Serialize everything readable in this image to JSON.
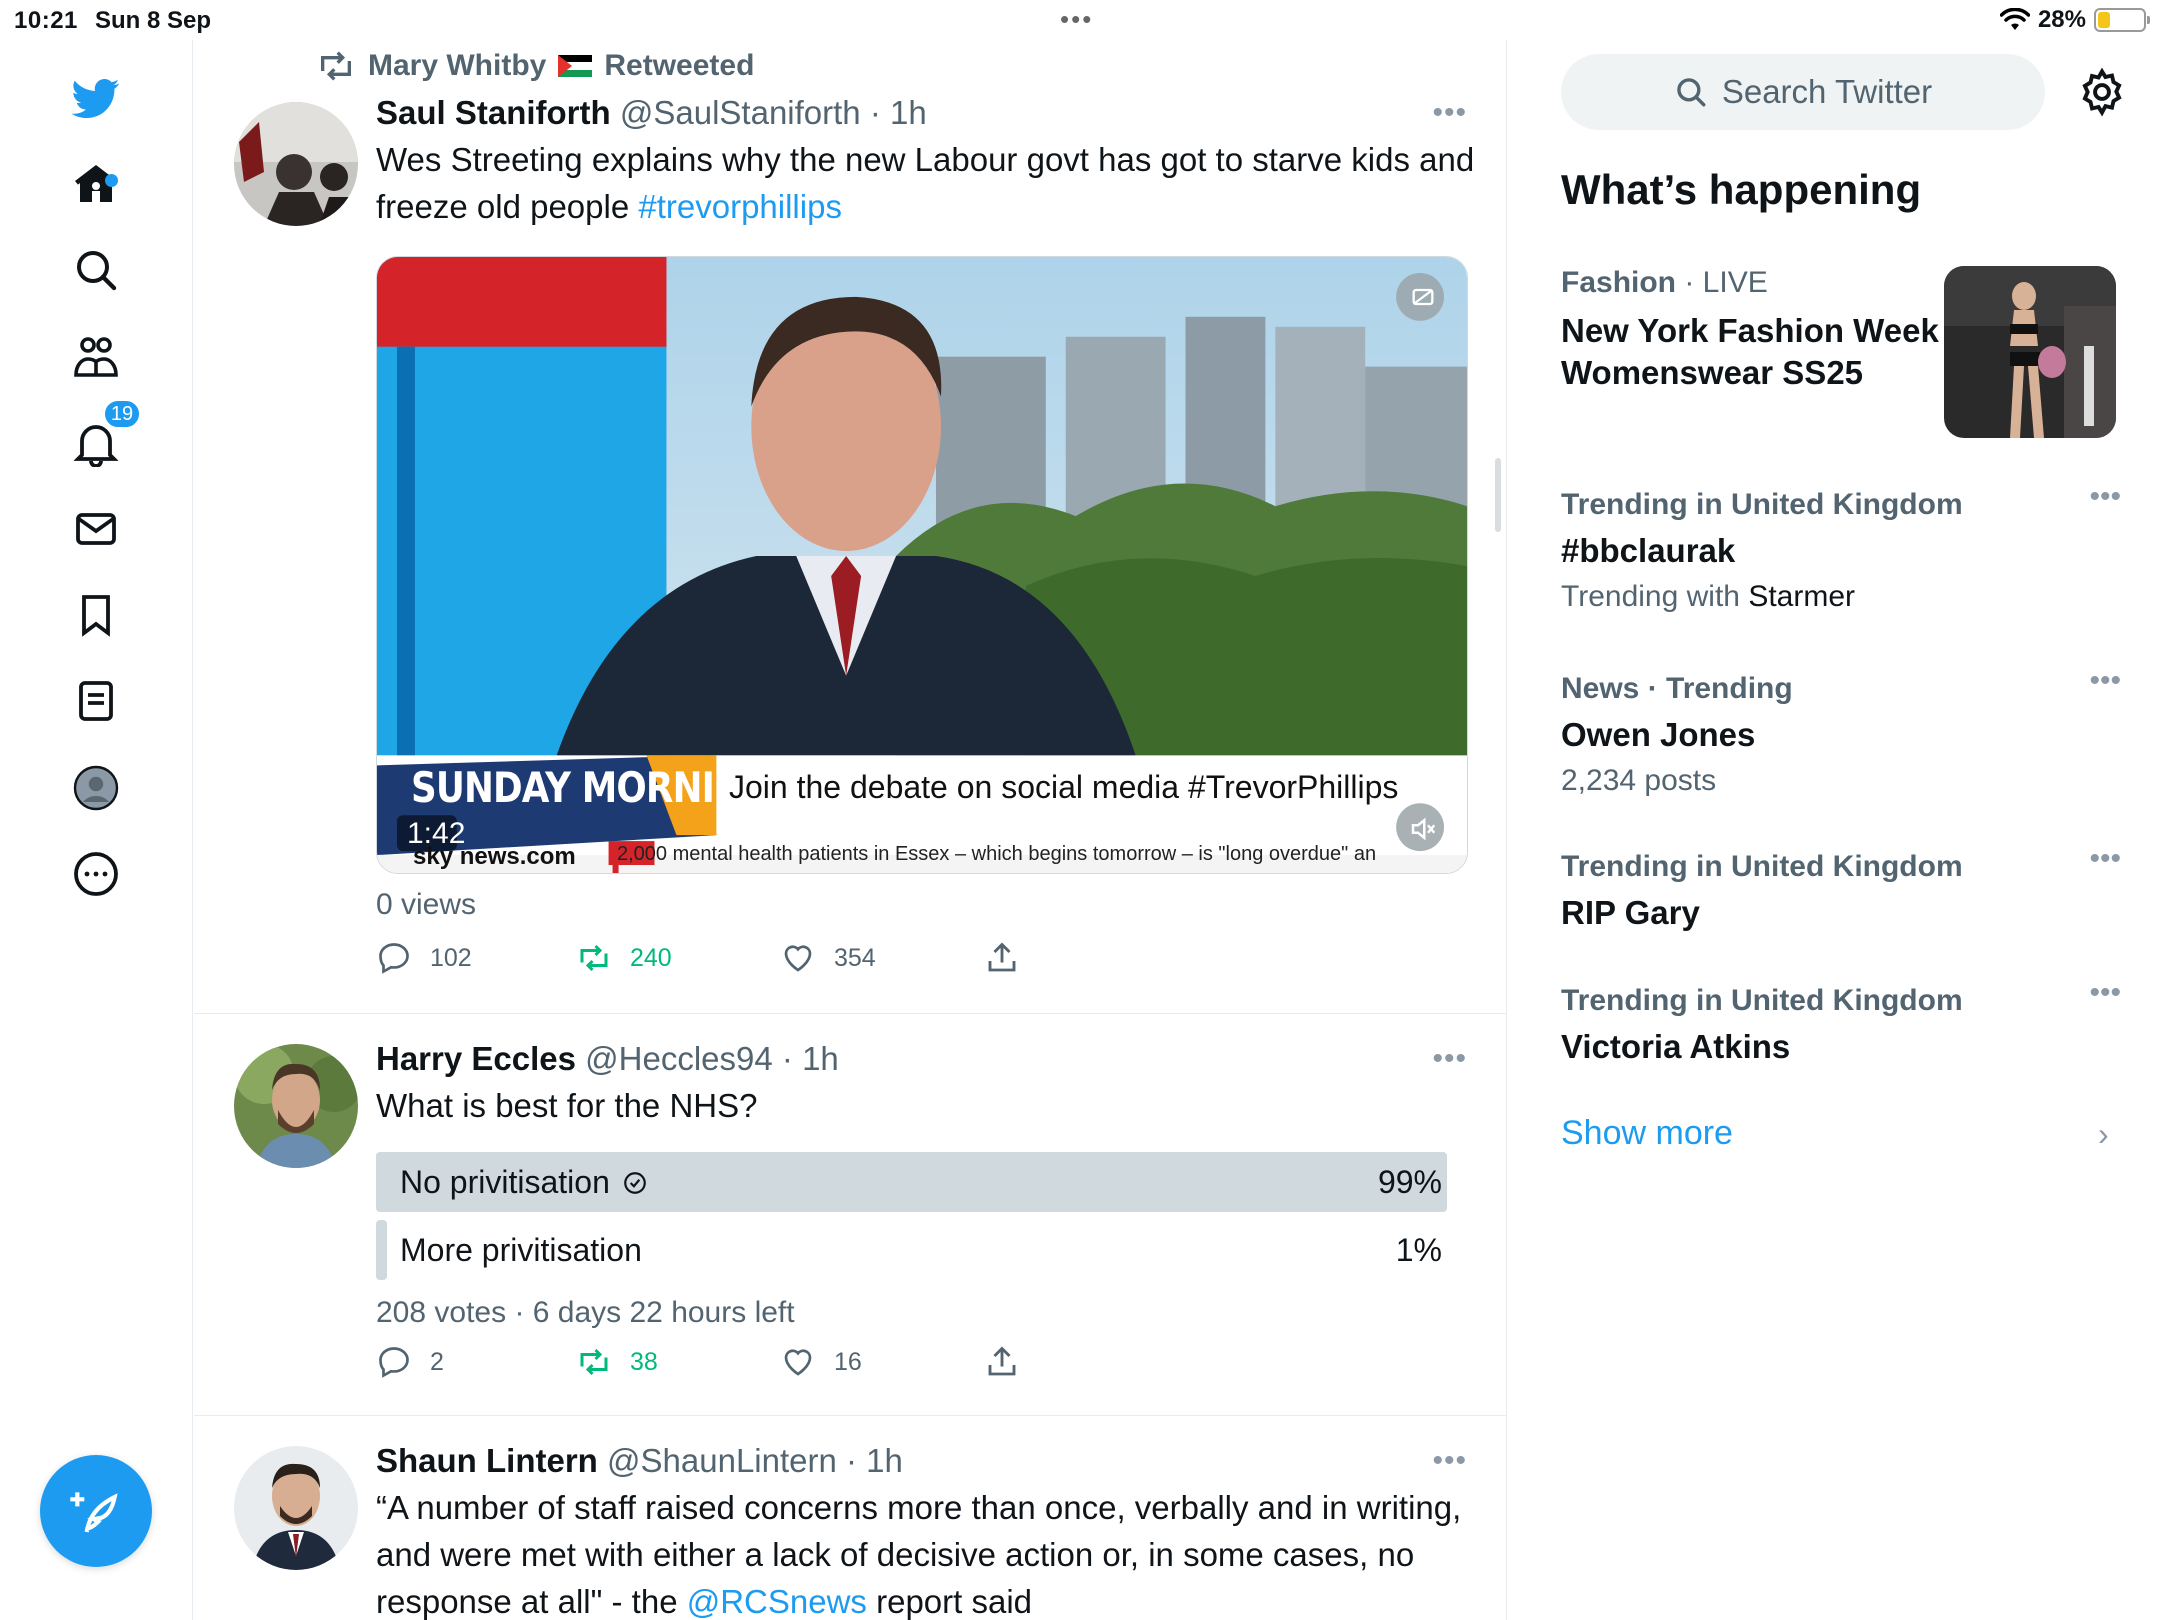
{
  "status_bar": {
    "time": "10:21",
    "date": "Sun 8 Sep",
    "battery": "28%",
    "battery_level": 0.28
  },
  "colors": {
    "accent": "#1d9bf0",
    "retweet_green": "#00ba7c",
    "muted": "#536471"
  },
  "nav": {
    "items": [
      "twitter-logo-icon",
      "home-icon",
      "search-icon",
      "communities-icon",
      "notifications-icon",
      "messages-icon",
      "bookmarks-icon",
      "lists-icon",
      "profile-icon",
      "more-icon"
    ],
    "notification_count": "19"
  },
  "tweets": [
    {
      "retweeted_by": "Mary Whitby",
      "retweeted_label": "Retweeted",
      "name": "Saul Staniforth",
      "handle": "@SaulStaniforth",
      "time": "· 1h",
      "text": "Wes Streeting explains why the new Labour govt has got to starve kids and freeze old people ",
      "hashtag": "#trevorphillips",
      "video": {
        "duration": "1:42",
        "banner": "SUNDAY MORNING",
        "caption": "Join the debate on social media #TrevorPhillips",
        "brand": "sky news",
        "brand_suffix": ".com",
        "ticker": "2,000 mental health patients in Essex – which begins tomorrow – is \"long overdue\" an"
      },
      "views": "0 views",
      "replies": "102",
      "retweets": "240",
      "likes": "354"
    },
    {
      "name": "Harry Eccles",
      "handle": "@Heccles94",
      "time": "· 1h",
      "text": "What is best for the NHS?",
      "poll": {
        "options": [
          {
            "label": "No privitisation",
            "pct": "99%",
            "fraction": 0.99
          },
          {
            "label": "More privitisation",
            "pct": "1%",
            "fraction": 0.01
          }
        ],
        "votes": "208 votes",
        "time_left": "· 6 days 22 hours left"
      },
      "replies": "2",
      "retweets": "38",
      "likes": "16"
    },
    {
      "name": "Shaun Lintern",
      "handle": "@ShaunLintern",
      "time": "· 1h",
      "text_before": "“A number of staff raised concerns more than once, verbally and in writing, and were met with either a lack of decisive action or, in some cases, no response at all\" - the ",
      "mention": "@RCSnews",
      "text_after": " report said"
    }
  ],
  "sidebar": {
    "search_placeholder": "Search Twitter",
    "title": "What’s happening",
    "trends": [
      {
        "category": "Fashion",
        "live": "· LIVE",
        "title": "New York Fashion Week Womenswear SS25"
      },
      {
        "category": "Trending in United Kingdom",
        "title": "#bbclaurak",
        "sub_prefix": "Trending with ",
        "sub_value": "Starmer"
      },
      {
        "category": "News · Trending",
        "title": "Owen Jones",
        "sub": "2,234 posts"
      },
      {
        "category": "Trending in United Kingdom",
        "title": "RIP Gary"
      },
      {
        "category": "Trending in United Kingdom",
        "title": "Victoria Atkins"
      }
    ],
    "show_more": "Show more"
  }
}
